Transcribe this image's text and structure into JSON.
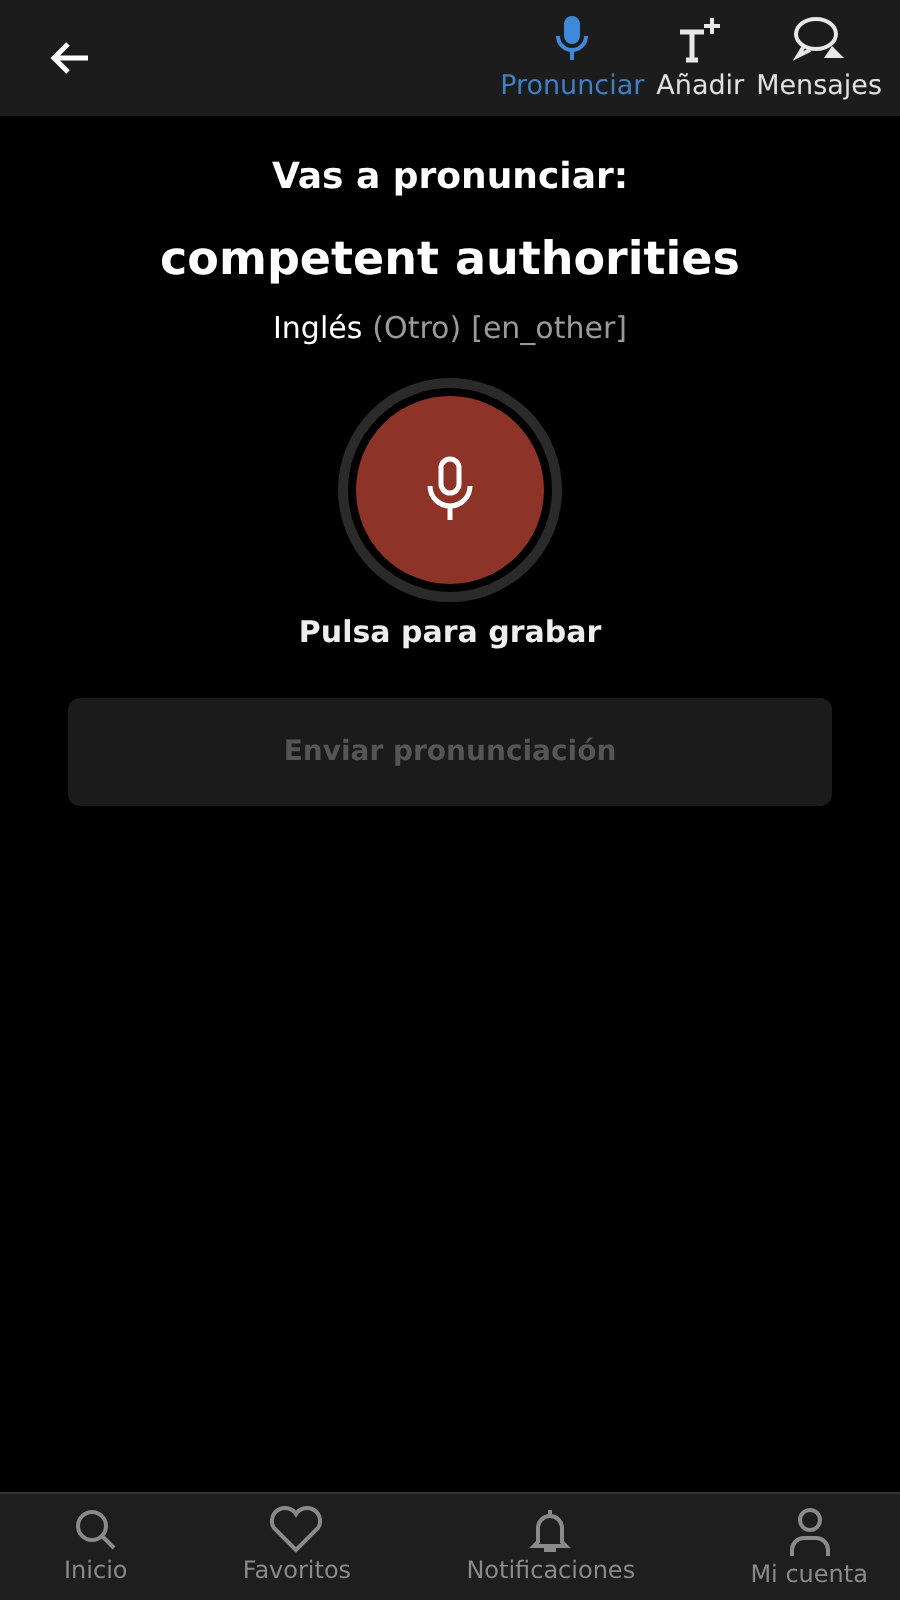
{
  "top_bar": {
    "tabs": [
      {
        "label": "Pronunciar",
        "kind": "mic",
        "selected": true
      },
      {
        "label": "Añadir",
        "kind": "add-text",
        "selected": false
      },
      {
        "label": "Mensajes",
        "kind": "chat",
        "selected": false
      }
    ]
  },
  "heading": "Vas a pronunciar:",
  "word": "competent authorities",
  "language": {
    "name": "Inglés",
    "variant": "(Otro)",
    "code": "[en_other]"
  },
  "record_hint": "Pulsa para grabar",
  "submit": {
    "label": "Enviar pronunciación",
    "disabled": true
  },
  "bottom_nav": [
    {
      "label": "Inicio",
      "kind": "search"
    },
    {
      "label": "Favoritos",
      "kind": "heart"
    },
    {
      "label": "Notificaciones",
      "kind": "bell"
    },
    {
      "label": "Mi cuenta",
      "kind": "person"
    }
  ]
}
